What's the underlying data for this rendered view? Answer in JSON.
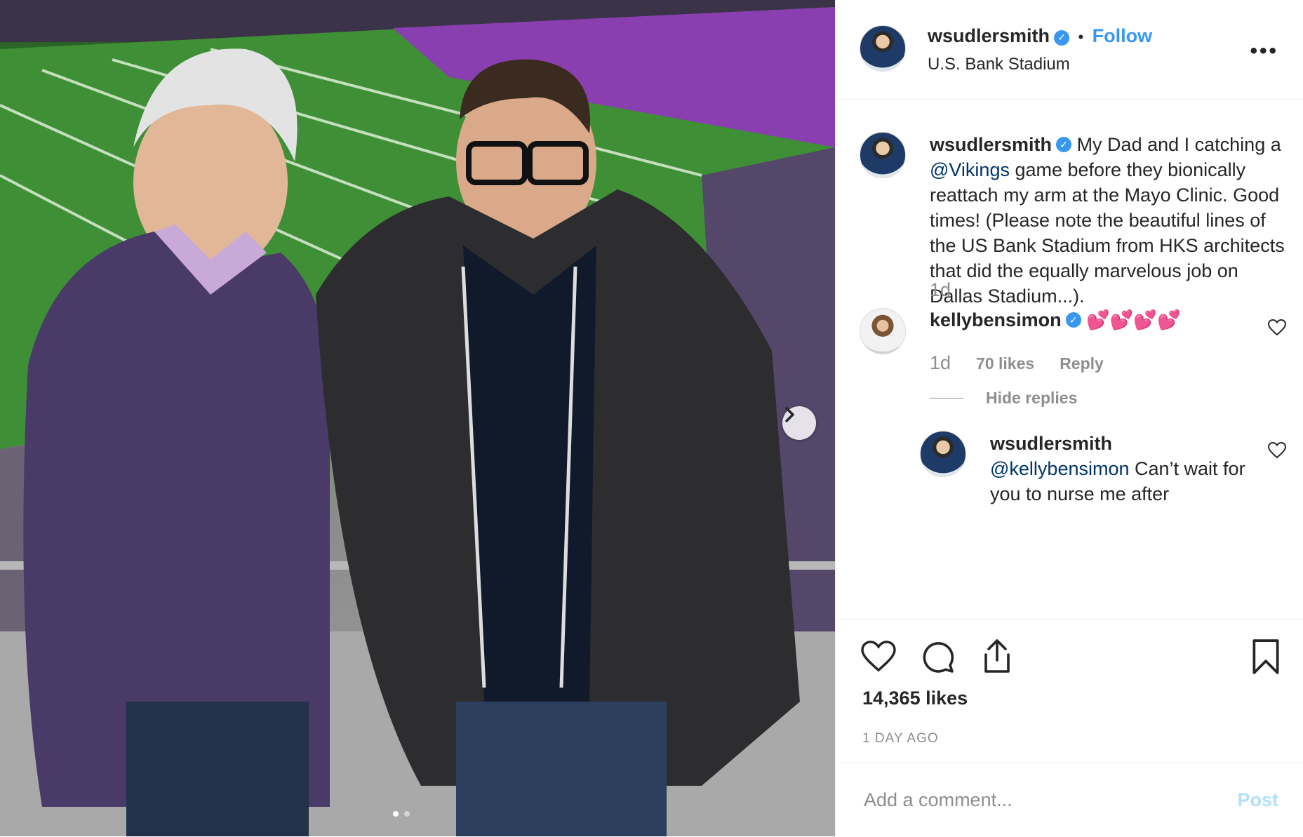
{
  "post": {
    "author": "wsudlersmith",
    "follow_label": "Follow",
    "separator": "•",
    "location": "U.S. Bank Stadium",
    "more_label": "•••"
  },
  "caption": {
    "author": "wsudlersmith",
    "text_before": "My Dad and I catching a ",
    "mention": "@Vikings",
    "text_after": " game before they bionically reattach my arm at the Mayo Clinic. Good times! (Please note the beautiful lines of the US Bank Stadium from HKS architects that did the equally marvelous job on Dallas Stadium...).",
    "time": "1d"
  },
  "comments": [
    {
      "author": "kellybensimon",
      "text": "💕💕💕💕",
      "time": "1d",
      "likes": "70 likes",
      "reply_label": "Reply",
      "hide_replies_label": "Hide replies",
      "replies": [
        {
          "author": "wsudlersmith",
          "mention": "@kellybensimon",
          "text": " Can’t wait for you to nurse me after"
        }
      ]
    }
  ],
  "actions": {
    "likes_count": "14,365 likes",
    "time_ago": "1 DAY AGO"
  },
  "add_comment": {
    "placeholder": "Add a comment...",
    "post_label": "Post"
  },
  "colors": {
    "accent": "#3897f0",
    "mention": "#003569",
    "muted": "#8e8e8e",
    "post_disabled": "#b2dffc"
  }
}
